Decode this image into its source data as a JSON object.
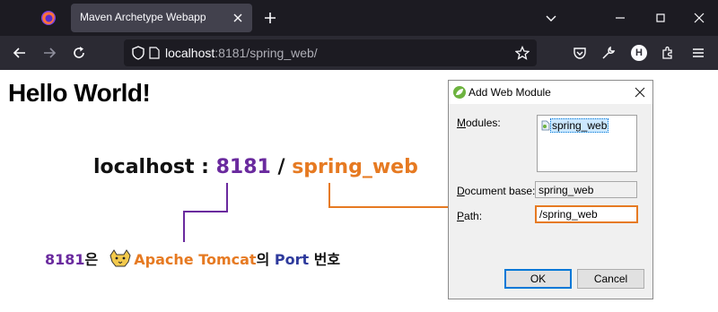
{
  "browser": {
    "tab_title": "Maven Archetype Webapp",
    "url_host": "localhost",
    "url_rest": ":8181/spring_web/",
    "profile_initial": "H",
    "theme": {
      "tabbar": "#1c1b22",
      "toolbar": "#2b2a33",
      "active_tab": "#42414d",
      "text": "#fbfbfe"
    }
  },
  "page": {
    "heading": "Hello World!"
  },
  "annotation": {
    "host": "localhost",
    "sep1": " : ",
    "port": "8181",
    "sep2": " / ",
    "context": "spring_web",
    "note_port": "8181",
    "note_particle1": "은",
    "note_app": "Apache Tomcat",
    "note_particle2": "의 ",
    "note_port_word": "Port",
    "note_suffix": " 번호",
    "colors": {
      "port": "#6a2a9e",
      "context": "#e67a22",
      "port_word": "#2e3a9c"
    }
  },
  "dialog": {
    "title": "Add Web Module",
    "modules_label_mnemonic": "M",
    "modules_label_rest": "odules:",
    "modules": [
      "spring_web"
    ],
    "docbase_label_mnemonic": "D",
    "docbase_label_rest": "ocument base:",
    "docbase_value": "spring_web",
    "path_label_mnemonic": "P",
    "path_label_rest": "ath:",
    "path_value": "/spring_web",
    "ok_label": "OK",
    "cancel_label": "Cancel"
  }
}
